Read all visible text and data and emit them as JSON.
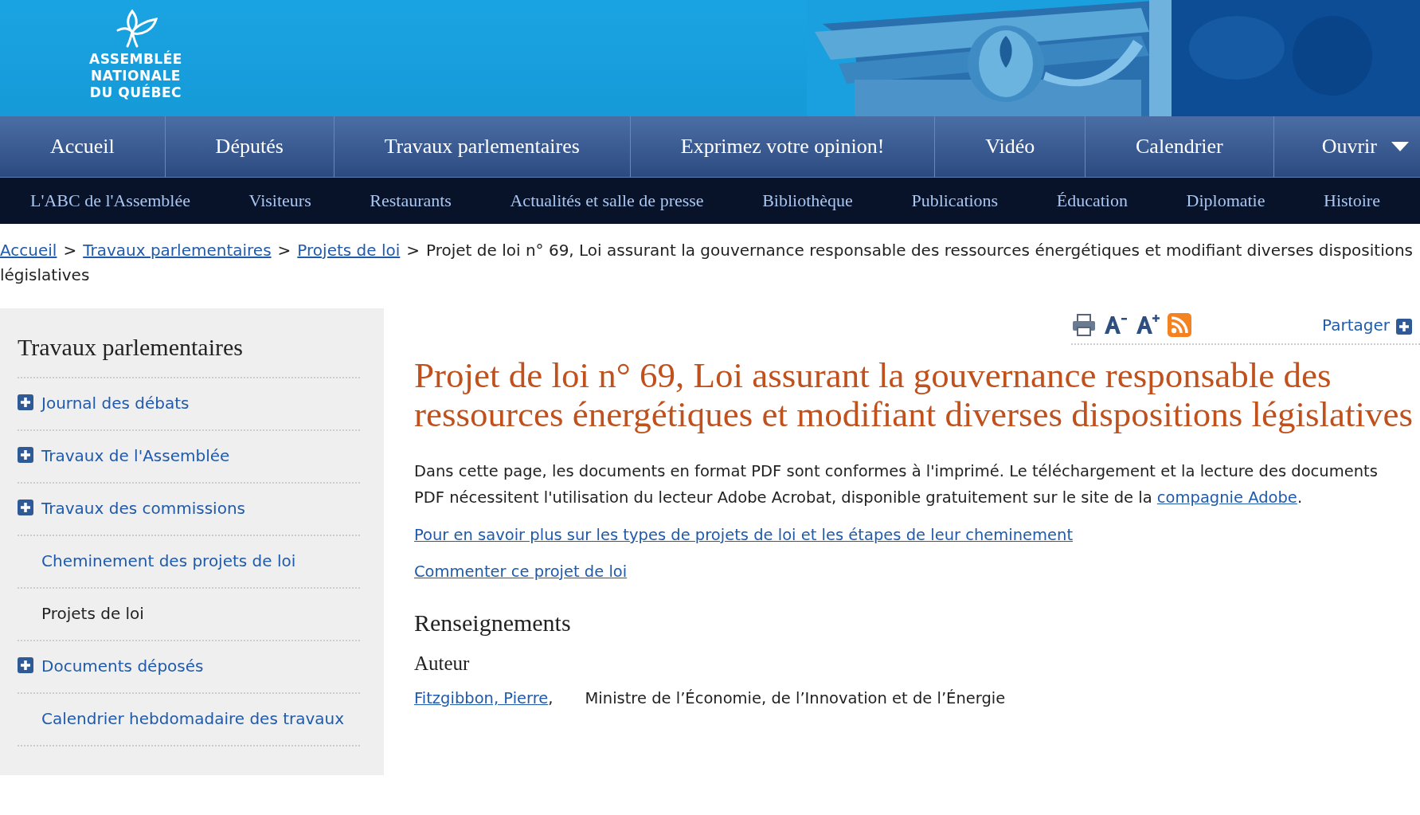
{
  "header": {
    "logo_lines": [
      "ASSEMBLÉE",
      "NATIONALE",
      "DU QUÉBEC"
    ]
  },
  "main_nav": [
    {
      "label": "Accueil",
      "kind": "link"
    },
    {
      "label": "Députés",
      "kind": "link"
    },
    {
      "label": "Travaux parlementaires",
      "kind": "link"
    },
    {
      "label": "Exprimez votre opinion!",
      "kind": "link"
    },
    {
      "label": "Vidéo",
      "kind": "link"
    },
    {
      "label": "Calendrier",
      "kind": "link"
    },
    {
      "label": "Ouvrir",
      "kind": "dropdown"
    }
  ],
  "sub_nav": [
    "L'ABC de l'Assemblée",
    "Visiteurs",
    "Restaurants",
    "Actualités et salle de presse",
    "Bibliothèque",
    "Publications",
    "Éducation",
    "Diplomatie",
    "Histoire"
  ],
  "breadcrumb": [
    {
      "label": "Accueil",
      "kind": "link"
    },
    {
      "label": ">",
      "kind": "separator"
    },
    {
      "label": "Travaux parlementaires",
      "kind": "link"
    },
    {
      "label": ">",
      "kind": "separator"
    },
    {
      "label": "Projets de loi",
      "kind": "link"
    },
    {
      "label": ">",
      "kind": "separator"
    },
    {
      "label": "Projet de loi n° 69, Loi assurant la gouvernance responsable des ressources énergétiques et modifiant diverses dispositions législatives",
      "kind": "current"
    }
  ],
  "sidebar": {
    "title": "Travaux parlementaires",
    "items": [
      {
        "label": "Journal des débats",
        "expandable": true,
        "selected": false
      },
      {
        "label": "Travaux de l'Assemblée",
        "expandable": true,
        "selected": false
      },
      {
        "label": "Travaux des commissions",
        "expandable": true,
        "selected": false
      },
      {
        "label": "Cheminement des projets de loi",
        "expandable": false,
        "selected": false
      },
      {
        "label": "Projets de loi",
        "expandable": false,
        "selected": true
      },
      {
        "label": "Documents déposés",
        "expandable": true,
        "selected": false
      },
      {
        "label": "Calendrier hebdomadaire des travaux",
        "expandable": false,
        "selected": false
      }
    ]
  },
  "toolbar": {
    "share_label": "Partager"
  },
  "content": {
    "title": "Projet de loi n° 69, Loi assurant la gouvernance responsable des ressources énergétiques et modifiant diverses dispositions législatives",
    "intro": {
      "text": "Dans cette page, les documents en format PDF sont conformes à l'imprimé. Le téléchargement et la lecture des documents PDF nécessitent l'utilisation du lecteur Adobe Acrobat, disponible gratuitement sur le site de la ",
      "link": "compagnie Adobe",
      "after": "."
    },
    "links": [
      "Pour en savoir plus sur les types de projets de loi et les étapes de leur cheminement",
      "Commenter ce projet de loi"
    ],
    "section_heading": "Renseignements",
    "subheading": "Auteur",
    "author": {
      "name": "Fitzgibbon, Pierre",
      "separator": ",",
      "role": "Ministre de l’Économie, de l’Innovation et de l’Énergie"
    }
  }
}
